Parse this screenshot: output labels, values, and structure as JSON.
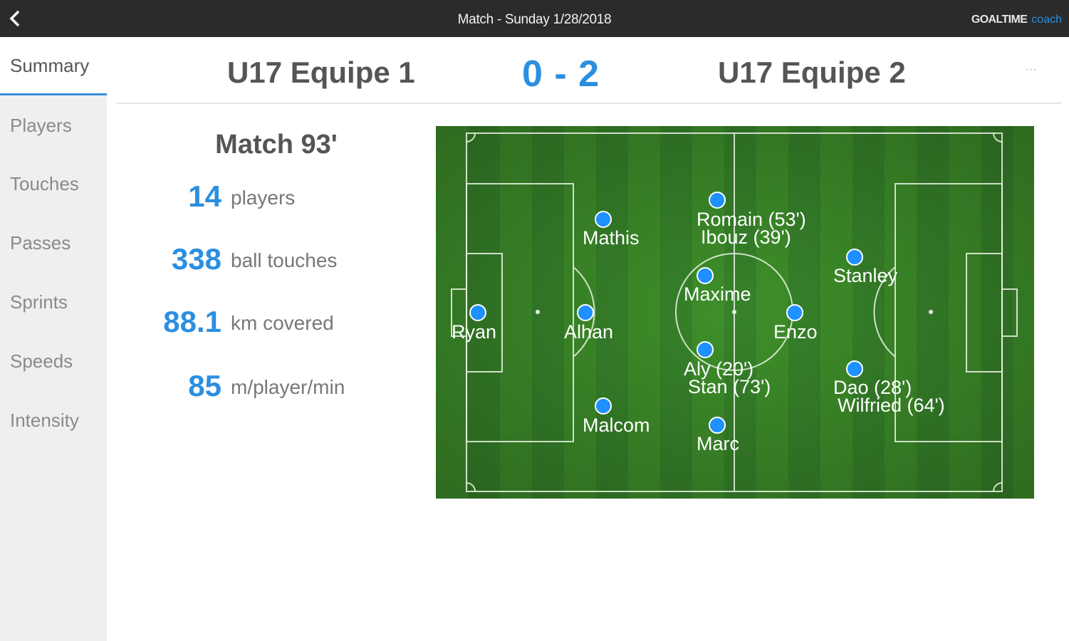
{
  "topbar": {
    "title": "Match - Sunday 1/28/2018",
    "brand_main": "GOALTIME",
    "brand_sub": "coach"
  },
  "sidebar": {
    "items": [
      {
        "label": "Summary",
        "active": true
      },
      {
        "label": "Players",
        "active": false
      },
      {
        "label": "Touches",
        "active": false
      },
      {
        "label": "Passes",
        "active": false
      },
      {
        "label": "Sprints",
        "active": false
      },
      {
        "label": "Speeds",
        "active": false
      },
      {
        "label": "Intensity",
        "active": false
      }
    ]
  },
  "match": {
    "team_home": "U17 Equipe 1",
    "score": "0 - 2",
    "team_away": "U17 Equipe 2",
    "more": "..."
  },
  "stats": {
    "duration": "Match 93'",
    "rows": [
      {
        "value": "14",
        "label": "players"
      },
      {
        "value": "338",
        "label": "ball touches"
      },
      {
        "value": "88.1",
        "label": "km covered"
      },
      {
        "value": "85",
        "label": "m/player/min"
      }
    ]
  },
  "formation": {
    "marker_color": "#1e90ff",
    "players": [
      {
        "name": "Ryan"
      },
      {
        "name": "Alhan"
      },
      {
        "name": "Mathis"
      },
      {
        "name": "Malcom"
      },
      {
        "name": "Romain (53')",
        "name2": "Ibouz (39')"
      },
      {
        "name": "Maxime"
      },
      {
        "name": "Aly (20')",
        "name2": "Stan (73')"
      },
      {
        "name": "Marc"
      },
      {
        "name": "Enzo"
      },
      {
        "name": "Stanley"
      },
      {
        "name": "Dao (28')",
        "name2": "Wilfried (64')"
      }
    ]
  }
}
